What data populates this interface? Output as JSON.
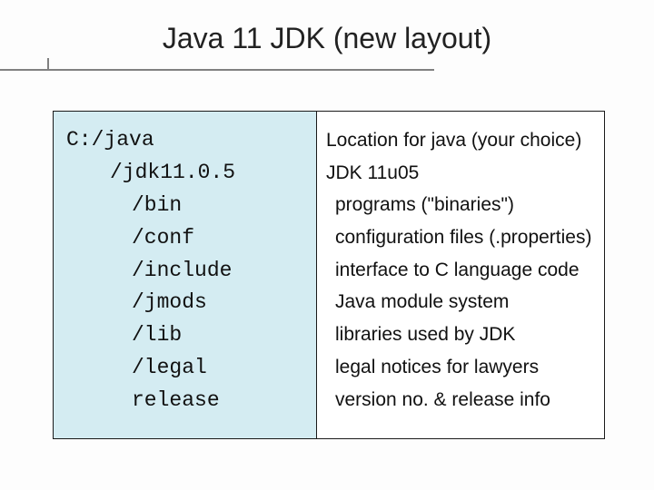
{
  "title": "Java 11 JDK (new layout)",
  "left": {
    "line0": "C:/java",
    "line1": "/jdk11.0.5",
    "line2": "/bin",
    "line3": "/conf",
    "line4": "/include",
    "line5": "/jmods",
    "line6": "/lib",
    "line7": "/legal",
    "line8": "release"
  },
  "right": {
    "line0": "Location for java (your choice)",
    "line1": "JDK 11u05",
    "line2": "programs (\"binaries\")",
    "line3": "configuration files (.properties)",
    "line4": "interface to C language code",
    "line5": "Java module system",
    "line6": "libraries used by JDK",
    "line7": "legal notices for lawyers",
    "line8": "version no. & release info"
  }
}
